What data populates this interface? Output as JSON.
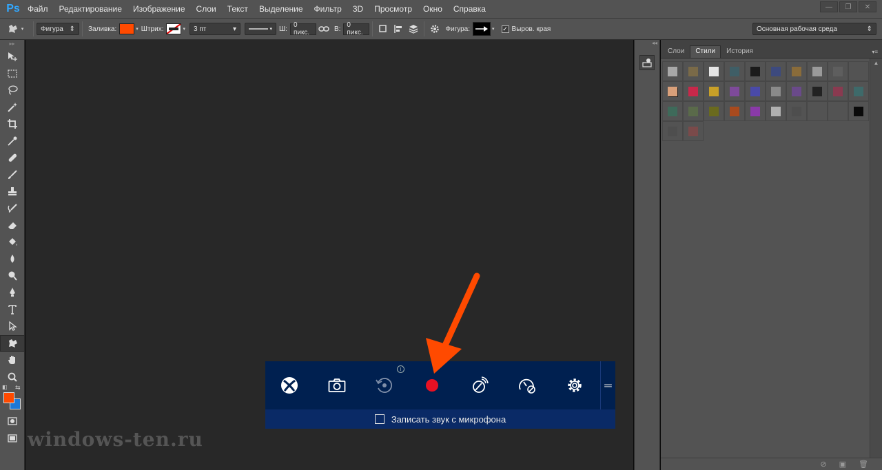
{
  "app": {
    "logo": "Ps"
  },
  "menu": [
    "Файл",
    "Редактирование",
    "Изображение",
    "Слои",
    "Текст",
    "Выделение",
    "Фильтр",
    "3D",
    "Просмотр",
    "Окно",
    "Справка"
  ],
  "window_controls": {
    "minimize": "—",
    "restore": "❐",
    "close": "✕"
  },
  "options": {
    "tool_dropdown": "Фигура",
    "fill_label": "Заливка:",
    "fill_color": "#ff4a00",
    "stroke_label": "Штрих:",
    "stroke_width": "3 пт",
    "w_label": "Ш:",
    "w_value": "0 пикс.",
    "h_label": "В:",
    "h_value": "0 пикс.",
    "shape_label": "Фигура:",
    "antialias_label": "Выров. края",
    "workspace": "Основная рабочая среда"
  },
  "toolbar": {
    "tools": [
      "move",
      "marquee",
      "lasso",
      "magic-wand",
      "crop",
      "eyedropper",
      "healing",
      "brush",
      "stamp",
      "history-brush",
      "eraser",
      "bucket",
      "blur",
      "dodge",
      "pen",
      "type",
      "path-select",
      "custom-shape",
      "hand",
      "zoom"
    ],
    "foreground_color": "#ff4a00",
    "background_color": "#1e78d7"
  },
  "panel": {
    "tabs": [
      "Слои",
      "Стили",
      "История"
    ],
    "active_tab": "Стили",
    "styles": [
      "#a8a8a8",
      "#7a6a48",
      "#e6e6e6",
      "#3f5e66",
      "#1b1b1b",
      "#3d4a7e",
      "#8a6c3a",
      "#9a9a9a",
      "#5e5e5e",
      "#535353",
      "#d9a07a",
      "#c8284a",
      "#c8a028",
      "#7e4a9a",
      "#4a4aa8",
      "#8a8a8a",
      "#6a4a8a",
      "#222222",
      "#8a3a50",
      "#3e6a6a",
      "#3e6a5a",
      "#5a6a4a",
      "#6a6a1e",
      "#a84a1e",
      "#8a3aa8",
      "#b0b0b0",
      "#4e4e4e",
      "#535353",
      "#535353",
      "#0a0a0a",
      "#4e4e4e",
      "#7a4a4a"
    ]
  },
  "gamebar": {
    "buttons": [
      "xbox-icon",
      "camera-icon",
      "record-last-icon",
      "record-icon",
      "broadcast-icon",
      "performance-icon",
      "settings-icon"
    ],
    "info": "i",
    "mic_label": "Записать звук с микрофона",
    "record_color": "#e81123"
  },
  "annotation": {
    "arrow_color": "#ff4a00"
  },
  "watermark": "windows-ten.ru"
}
